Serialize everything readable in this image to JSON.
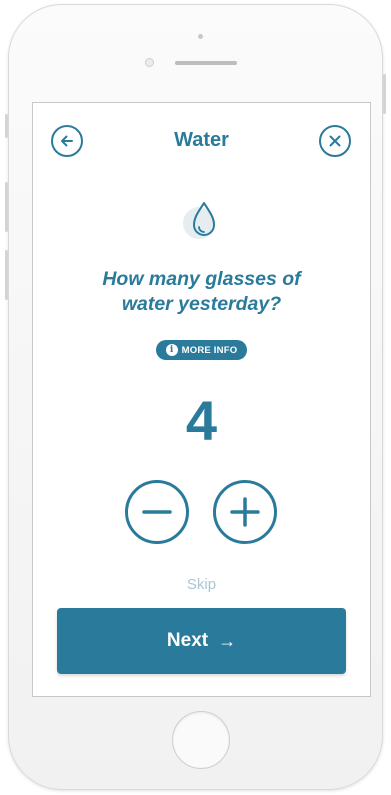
{
  "header": {
    "title": "Water",
    "back_icon": "arrow-left-icon",
    "close_icon": "close-icon"
  },
  "question": {
    "icon": "water-drop-icon",
    "line1": "How many glasses of",
    "line2": "water yesterday?"
  },
  "more_info": {
    "icon": "info-icon",
    "icon_glyph": "i",
    "label": "MORE INFO"
  },
  "counter": {
    "value": "4",
    "decrement_icon": "minus-icon",
    "increment_icon": "plus-icon"
  },
  "actions": {
    "skip_label": "Skip",
    "next_label": "Next",
    "next_arrow": "→"
  },
  "colors": {
    "accent": "#2a7b9b",
    "skip_text": "#a9c6d3"
  }
}
